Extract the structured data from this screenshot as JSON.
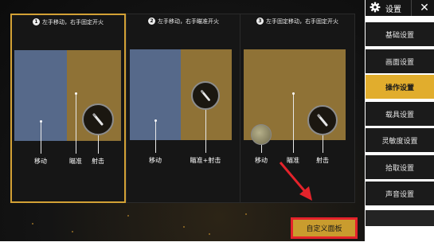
{
  "options": [
    {
      "number": "1",
      "title": "左手移动，右手固定开火",
      "labels": [
        "移动",
        "瞄准",
        "射击"
      ]
    },
    {
      "number": "2",
      "title": "左手移动，右手瞄准开火",
      "labels": [
        "移动",
        "瞄准+射击"
      ]
    },
    {
      "number": "3",
      "title": "左手固定移动，右手固定开火",
      "labels": [
        "移动",
        "瞄准",
        "射击"
      ]
    }
  ],
  "custom_button": "自定义面板",
  "sidebar": {
    "title": "设置",
    "close": "✕",
    "items": [
      "基础设置",
      "画面设置",
      "操作设置",
      "载具设置",
      "灵敏度设置",
      "拾取设置",
      "声音设置"
    ],
    "active_item": "操作设置"
  },
  "colors": {
    "accent": "#e1ad2d",
    "move_zone": "#56698a",
    "aim_zone": "#8f7236",
    "highlight": "#e4232b"
  },
  "icons": [
    "gear-icon",
    "close-icon",
    "fire-button-icon",
    "joystick-icon",
    "arrow-icon"
  ]
}
